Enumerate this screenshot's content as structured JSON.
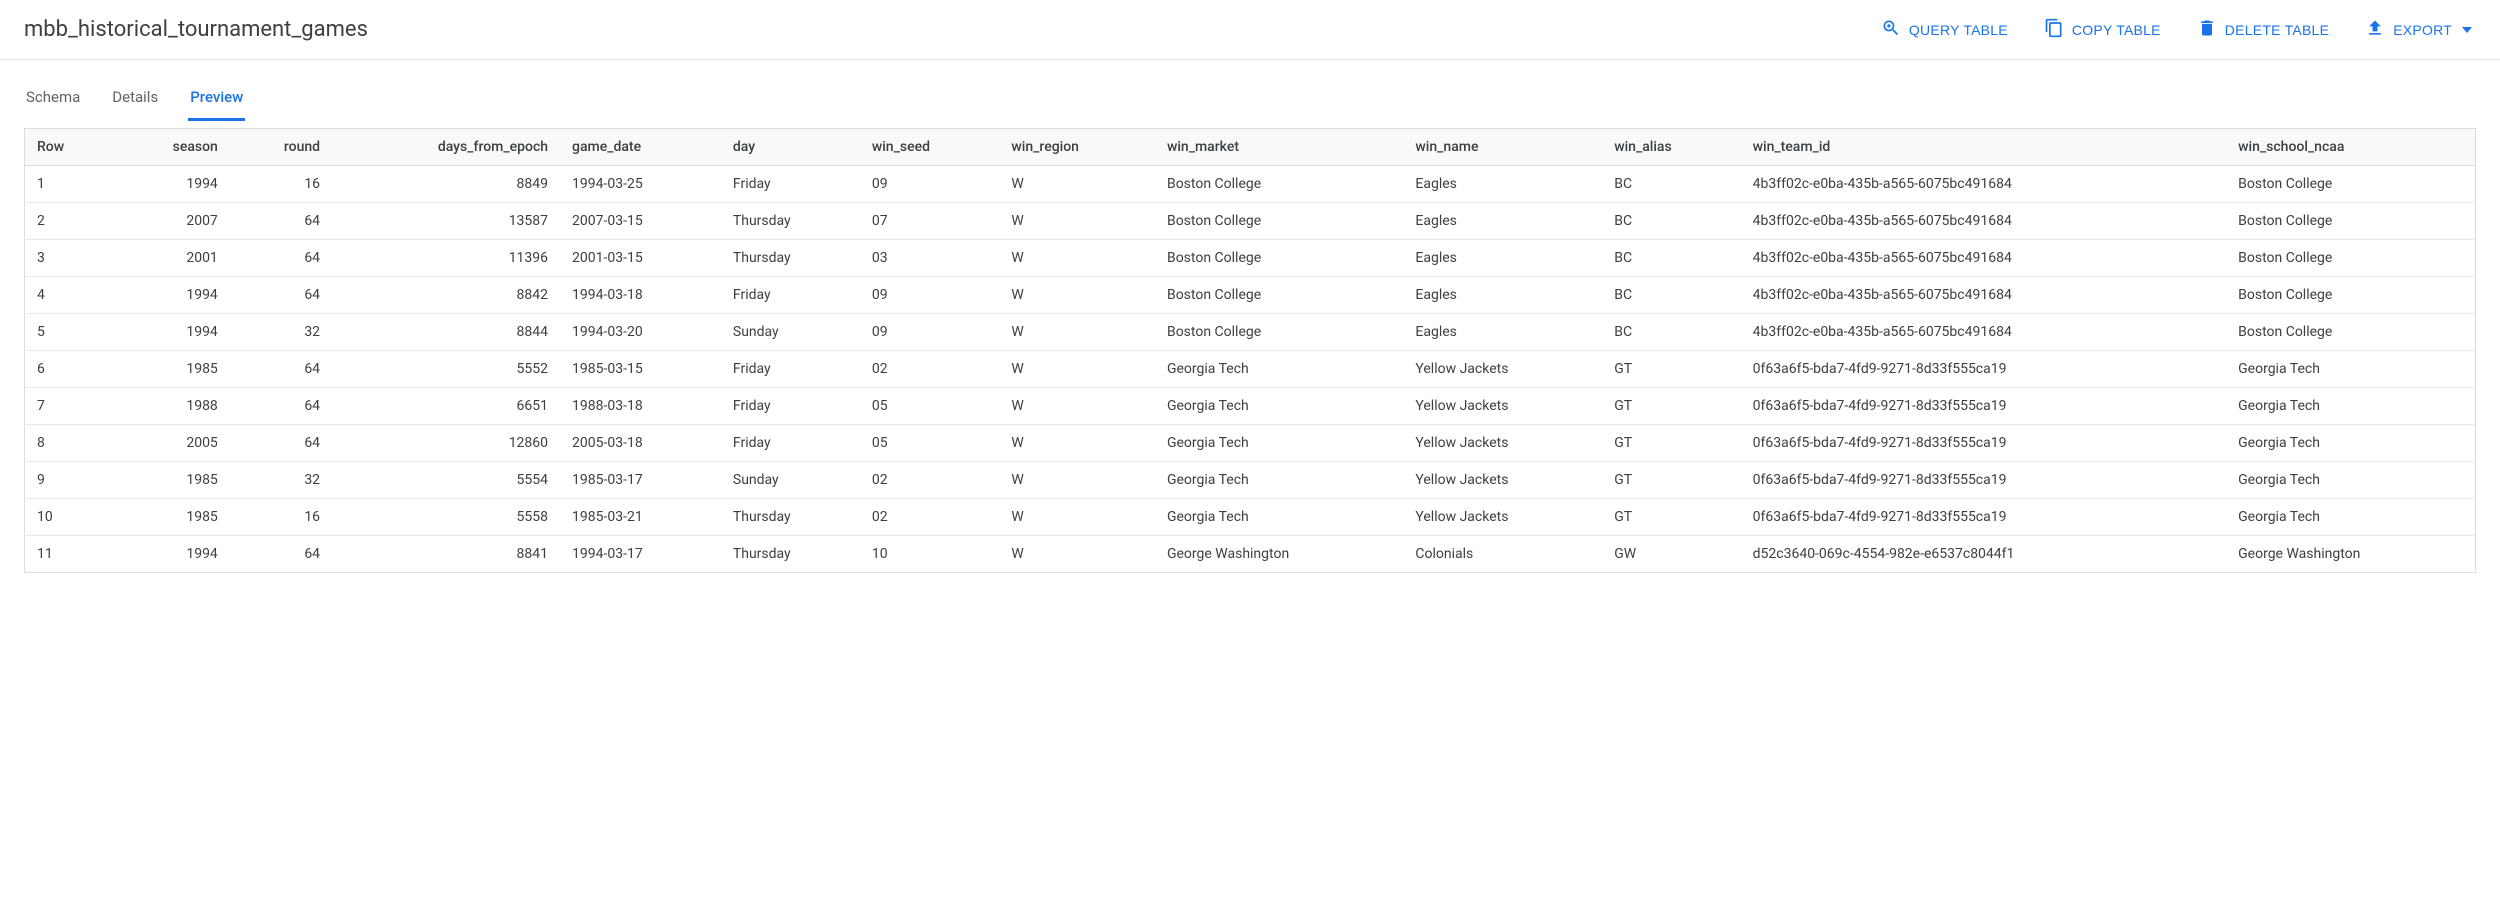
{
  "header": {
    "title": "mbb_historical_tournament_games",
    "actions": {
      "query": "QUERY TABLE",
      "copy": "COPY TABLE",
      "delete": "DELETE TABLE",
      "export": "EXPORT"
    }
  },
  "tabs": {
    "schema": "Schema",
    "details": "Details",
    "preview": "Preview"
  },
  "table": {
    "columns": {
      "row": "Row",
      "season": "season",
      "round": "round",
      "days_from_epoch": "days_from_epoch",
      "game_date": "game_date",
      "day": "day",
      "win_seed": "win_seed",
      "win_region": "win_region",
      "win_market": "win_market",
      "win_name": "win_name",
      "win_alias": "win_alias",
      "win_team_id": "win_team_id",
      "win_school_ncaa": "win_school_ncaa"
    },
    "rows": [
      {
        "row": "1",
        "season": "1994",
        "round": "16",
        "days_from_epoch": "8849",
        "game_date": "1994-03-25",
        "day": "Friday",
        "win_seed": "09",
        "win_region": "W",
        "win_market": "Boston College",
        "win_name": "Eagles",
        "win_alias": "BC",
        "win_team_id": "4b3ff02c-e0ba-435b-a565-6075bc491684",
        "win_school_ncaa": "Boston College"
      },
      {
        "row": "2",
        "season": "2007",
        "round": "64",
        "days_from_epoch": "13587",
        "game_date": "2007-03-15",
        "day": "Thursday",
        "win_seed": "07",
        "win_region": "W",
        "win_market": "Boston College",
        "win_name": "Eagles",
        "win_alias": "BC",
        "win_team_id": "4b3ff02c-e0ba-435b-a565-6075bc491684",
        "win_school_ncaa": "Boston College"
      },
      {
        "row": "3",
        "season": "2001",
        "round": "64",
        "days_from_epoch": "11396",
        "game_date": "2001-03-15",
        "day": "Thursday",
        "win_seed": "03",
        "win_region": "W",
        "win_market": "Boston College",
        "win_name": "Eagles",
        "win_alias": "BC",
        "win_team_id": "4b3ff02c-e0ba-435b-a565-6075bc491684",
        "win_school_ncaa": "Boston College"
      },
      {
        "row": "4",
        "season": "1994",
        "round": "64",
        "days_from_epoch": "8842",
        "game_date": "1994-03-18",
        "day": "Friday",
        "win_seed": "09",
        "win_region": "W",
        "win_market": "Boston College",
        "win_name": "Eagles",
        "win_alias": "BC",
        "win_team_id": "4b3ff02c-e0ba-435b-a565-6075bc491684",
        "win_school_ncaa": "Boston College"
      },
      {
        "row": "5",
        "season": "1994",
        "round": "32",
        "days_from_epoch": "8844",
        "game_date": "1994-03-20",
        "day": "Sunday",
        "win_seed": "09",
        "win_region": "W",
        "win_market": "Boston College",
        "win_name": "Eagles",
        "win_alias": "BC",
        "win_team_id": "4b3ff02c-e0ba-435b-a565-6075bc491684",
        "win_school_ncaa": "Boston College"
      },
      {
        "row": "6",
        "season": "1985",
        "round": "64",
        "days_from_epoch": "5552",
        "game_date": "1985-03-15",
        "day": "Friday",
        "win_seed": "02",
        "win_region": "W",
        "win_market": "Georgia Tech",
        "win_name": "Yellow Jackets",
        "win_alias": "GT",
        "win_team_id": "0f63a6f5-bda7-4fd9-9271-8d33f555ca19",
        "win_school_ncaa": "Georgia Tech"
      },
      {
        "row": "7",
        "season": "1988",
        "round": "64",
        "days_from_epoch": "6651",
        "game_date": "1988-03-18",
        "day": "Friday",
        "win_seed": "05",
        "win_region": "W",
        "win_market": "Georgia Tech",
        "win_name": "Yellow Jackets",
        "win_alias": "GT",
        "win_team_id": "0f63a6f5-bda7-4fd9-9271-8d33f555ca19",
        "win_school_ncaa": "Georgia Tech"
      },
      {
        "row": "8",
        "season": "2005",
        "round": "64",
        "days_from_epoch": "12860",
        "game_date": "2005-03-18",
        "day": "Friday",
        "win_seed": "05",
        "win_region": "W",
        "win_market": "Georgia Tech",
        "win_name": "Yellow Jackets",
        "win_alias": "GT",
        "win_team_id": "0f63a6f5-bda7-4fd9-9271-8d33f555ca19",
        "win_school_ncaa": "Georgia Tech"
      },
      {
        "row": "9",
        "season": "1985",
        "round": "32",
        "days_from_epoch": "5554",
        "game_date": "1985-03-17",
        "day": "Sunday",
        "win_seed": "02",
        "win_region": "W",
        "win_market": "Georgia Tech",
        "win_name": "Yellow Jackets",
        "win_alias": "GT",
        "win_team_id": "0f63a6f5-bda7-4fd9-9271-8d33f555ca19",
        "win_school_ncaa": "Georgia Tech"
      },
      {
        "row": "10",
        "season": "1985",
        "round": "16",
        "days_from_epoch": "5558",
        "game_date": "1985-03-21",
        "day": "Thursday",
        "win_seed": "02",
        "win_region": "W",
        "win_market": "Georgia Tech",
        "win_name": "Yellow Jackets",
        "win_alias": "GT",
        "win_team_id": "0f63a6f5-bda7-4fd9-9271-8d33f555ca19",
        "win_school_ncaa": "Georgia Tech"
      },
      {
        "row": "11",
        "season": "1994",
        "round": "64",
        "days_from_epoch": "8841",
        "game_date": "1994-03-17",
        "day": "Thursday",
        "win_seed": "10",
        "win_region": "W",
        "win_market": "George Washington",
        "win_name": "Colonials",
        "win_alias": "GW",
        "win_team_id": "d52c3640-069c-4554-982e-e6537c8044f1",
        "win_school_ncaa": "George Washington"
      }
    ]
  }
}
